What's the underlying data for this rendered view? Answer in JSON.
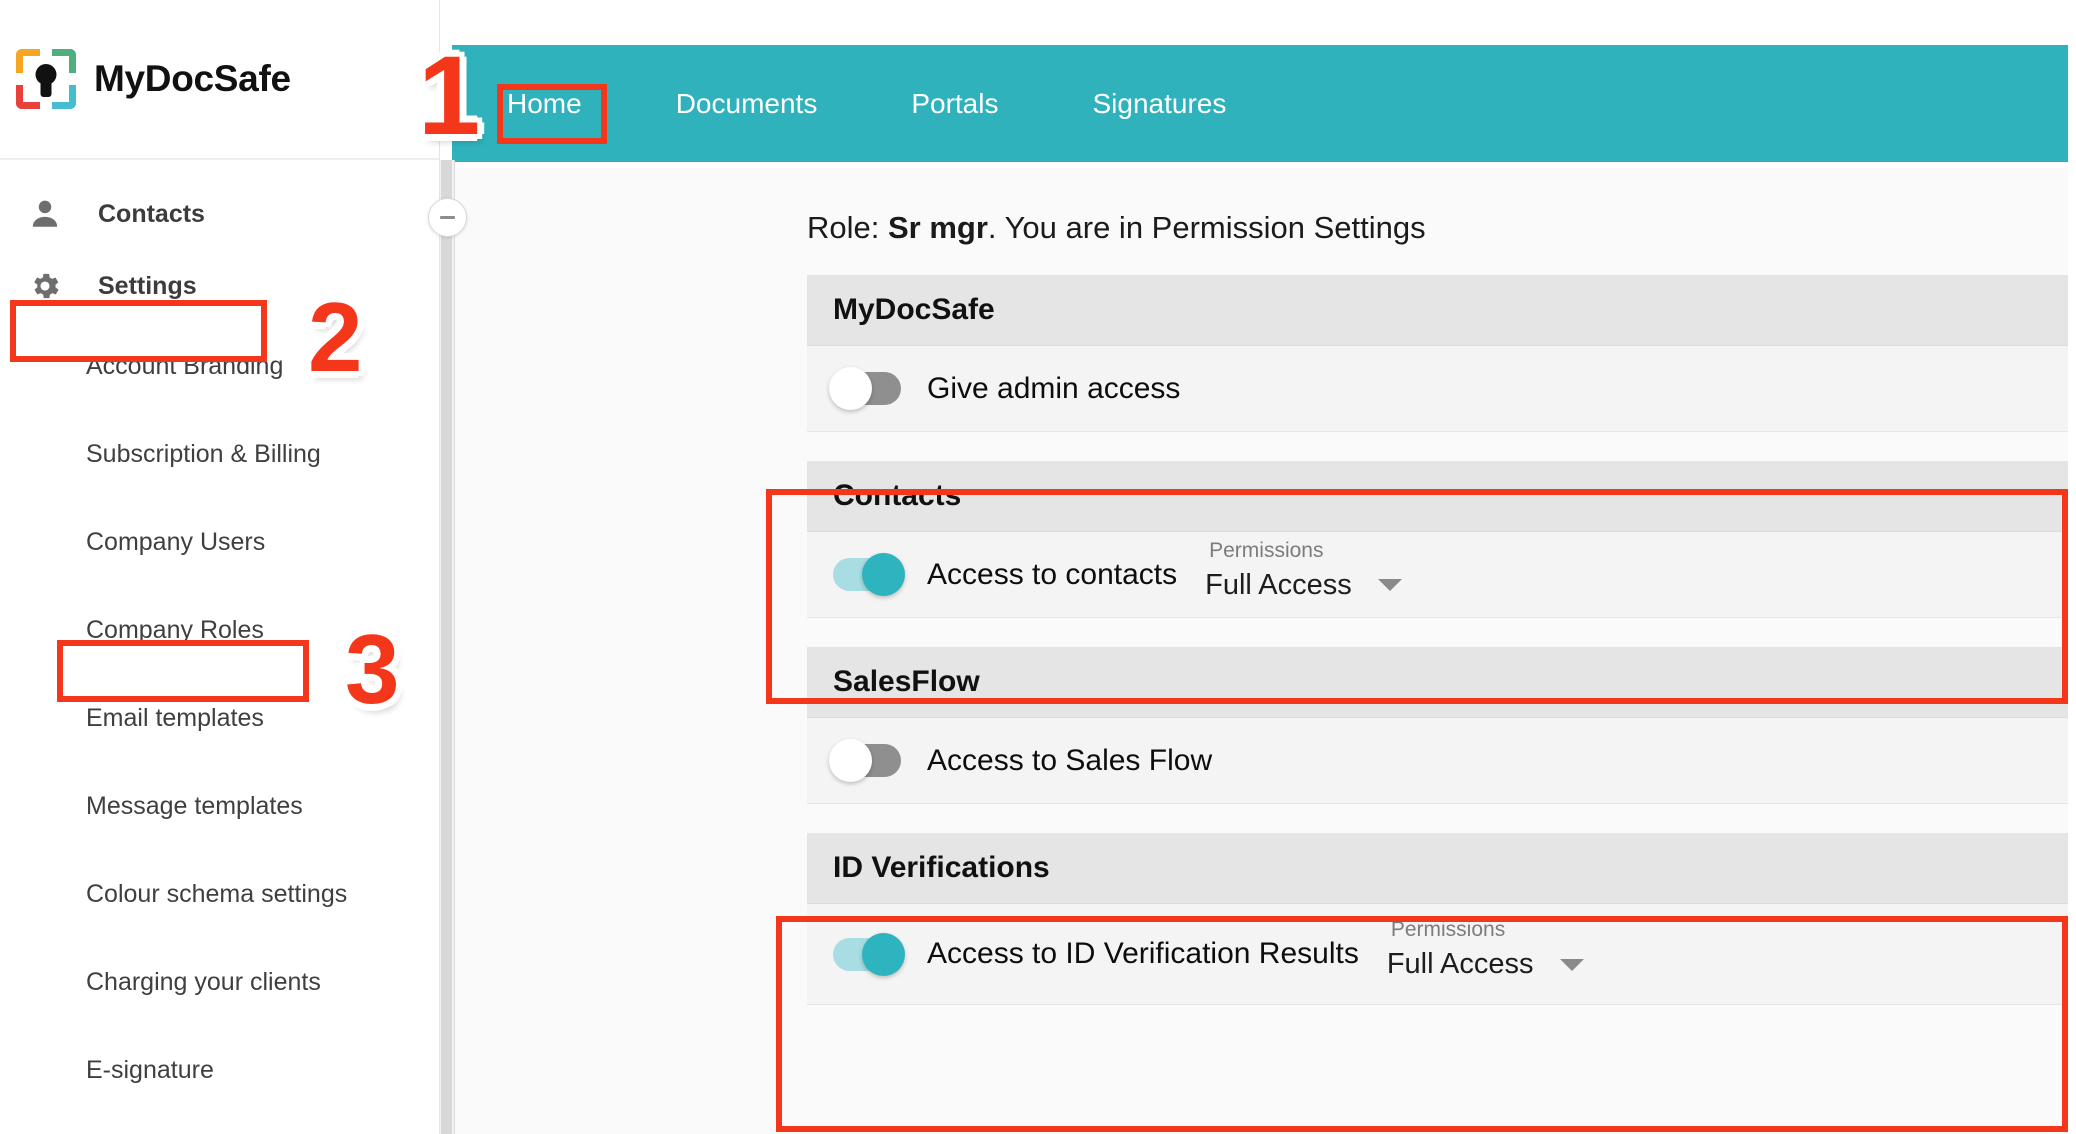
{
  "brand": {
    "name": "MyDocSafe",
    "logo_icon": "shield-brackets-keyhole-icon"
  },
  "topnav": {
    "items": [
      {
        "label": "Home",
        "active": true
      },
      {
        "label": "Documents",
        "active": false
      },
      {
        "label": "Portals",
        "active": false
      },
      {
        "label": "Signatures",
        "active": false
      }
    ]
  },
  "sidebar": {
    "top_items": [
      {
        "label": "Contacts",
        "icon": "person-icon"
      },
      {
        "label": "Settings",
        "icon": "gear-icon"
      }
    ],
    "sub_items": [
      {
        "label": "Account Branding"
      },
      {
        "label": "Subscription & Billing"
      },
      {
        "label": "Company Users"
      },
      {
        "label": "Company Roles"
      },
      {
        "label": "Email templates"
      },
      {
        "label": "Message templates"
      },
      {
        "label": "Colour schema settings"
      },
      {
        "label": "Charging your clients"
      },
      {
        "label": "E-signature"
      }
    ],
    "collapse_handle_icon": "minus-icon"
  },
  "main": {
    "role_prefix": "Role:",
    "role_name": "Sr mgr",
    "role_suffix": ". You are in Permission Settings",
    "permissions_caption": "Permissions",
    "sections": [
      {
        "title": "MyDocSafe",
        "rows": [
          {
            "label": "Give admin access",
            "toggle": "off",
            "has_permission": false
          }
        ]
      },
      {
        "title": "Contacts",
        "rows": [
          {
            "label": "Access to contacts",
            "toggle": "on",
            "has_permission": true,
            "permission_value": "Full Access"
          }
        ]
      },
      {
        "title": "SalesFlow",
        "rows": [
          {
            "label": "Access to Sales Flow",
            "toggle": "off",
            "has_permission": false
          }
        ]
      },
      {
        "title": "ID Verifications",
        "rows": [
          {
            "label": "Access to ID Verification Results",
            "toggle": "on",
            "has_permission": true,
            "permission_value": "Full Access"
          }
        ]
      }
    ]
  },
  "annotations": {
    "numbers": [
      {
        "text": "1"
      },
      {
        "text": "2"
      },
      {
        "text": "3"
      }
    ],
    "color": "#F4361A"
  },
  "colors": {
    "brand_teal": "#30B2BD",
    "toggle_on_track": "#A8DDE3",
    "toggle_on_knob": "#2DB4BF",
    "toggle_off_track": "#8F8F8F",
    "section_header_bg": "#E5E5E5",
    "row_bg": "#F4F4F4",
    "annotation_red": "#F4361A"
  }
}
